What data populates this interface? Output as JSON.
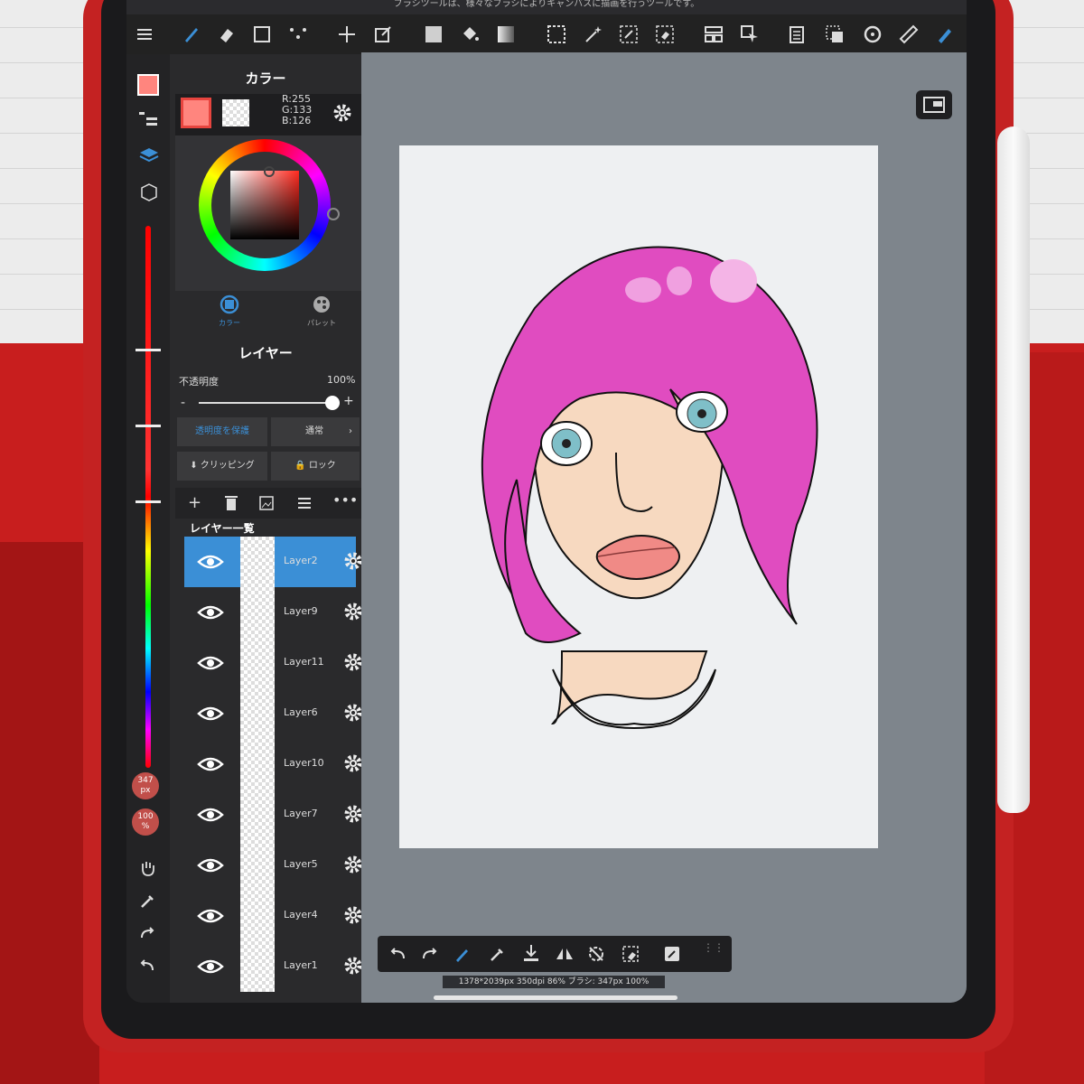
{
  "status_message": "ブラシツールは、様々なブラシによりキャンバスに描画を行うツールです。",
  "panels": {
    "color_title": "カラー",
    "rgb": {
      "r": "R:255",
      "g": "G:133",
      "b": "B:126"
    },
    "color_tab": "カラー",
    "palette_tab": "パレット",
    "layer_title": "レイヤー",
    "opacity_label": "不透明度",
    "opacity_value": "100%",
    "protect_alpha": "透明度を保護",
    "blend_mode": "通常",
    "clipping": "クリッピング",
    "lock": "ロック",
    "layer_list_title": "レイヤー一覧"
  },
  "layers": [
    {
      "name": "Layer2",
      "selected": true
    },
    {
      "name": "Layer9",
      "selected": false
    },
    {
      "name": "Layer11",
      "selected": false
    },
    {
      "name": "Layer6",
      "selected": false
    },
    {
      "name": "Layer10",
      "selected": false
    },
    {
      "name": "Layer7",
      "selected": false
    },
    {
      "name": "Layer5",
      "selected": false
    },
    {
      "name": "Layer4",
      "selected": false
    },
    {
      "name": "Layer1",
      "selected": false
    }
  ],
  "brush": {
    "size": "347",
    "size_unit": "px",
    "opacity": "100",
    "opacity_unit": "%"
  },
  "canvas_status": "1378*2039px 350dpi 86% ブラシ: 347px 100%",
  "colors": {
    "main": "#ff857e",
    "accent": "#3b8fd6",
    "hair": "#e04cc0",
    "skin": "#f7d9c0"
  },
  "icons": [
    "menu-icon",
    "brush-icon",
    "eraser-icon",
    "rect-select-icon",
    "dot-icon",
    "move-icon",
    "transform-icon",
    "fill-color-icon",
    "bucket-icon",
    "gradient-icon",
    "selection-icon",
    "magic-wand-icon",
    "select-pen-icon",
    "select-eraser-icon",
    "layout-icon",
    "pointer-icon",
    "material-icon",
    "snap-icon",
    "rotate-icon",
    "ruler-icon",
    "pen-icon"
  ]
}
